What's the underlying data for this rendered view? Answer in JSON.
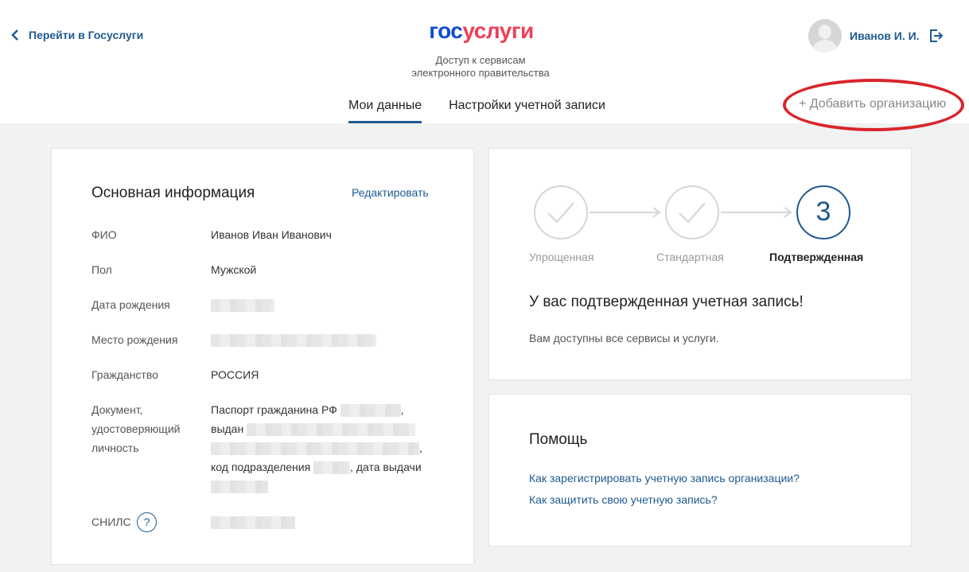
{
  "header": {
    "back_link": "Перейти в Госуслуги",
    "logo_part1": "гос",
    "logo_part2": "услуги",
    "tagline_line1": "Доступ к сервисам",
    "tagline_line2": "электронного правительства",
    "user_name": "Иванов И. И.",
    "tabs": [
      {
        "label": "Мои данные",
        "active": true
      },
      {
        "label": "Настройки учетной записи",
        "active": false
      }
    ],
    "add_org": "+ Добавить организацию"
  },
  "main_info": {
    "title": "Основная информация",
    "edit": "Редактировать",
    "rows": {
      "fio": {
        "label": "ФИО",
        "value": "Иванов Иван Иванович"
      },
      "gender": {
        "label": "Пол",
        "value": "Мужской"
      },
      "birth_date": {
        "label": "Дата рождения"
      },
      "birth_place": {
        "label": "Место рождения"
      },
      "citizenship": {
        "label": "Гражданство",
        "value": "РОССИЯ"
      },
      "document": {
        "label_line1": "Документ,",
        "label_line2": "удостоверяющий",
        "label_line3": "личность",
        "passport": "Паспорт гражданина РФ",
        "issued": "выдан",
        "dept_code": "код подразделения",
        "issue_date": ", дата выдачи",
        "comma": ","
      },
      "snils": {
        "label": "СНИЛС",
        "help": "?"
      }
    }
  },
  "status": {
    "steps": [
      {
        "label": "Упрощенная",
        "state": "done"
      },
      {
        "label": "Стандартная",
        "state": "done"
      },
      {
        "label": "Подтвержденная",
        "state": "current",
        "number": "3"
      }
    ],
    "title": "У вас подтвержденная учетная запись!",
    "description": "Вам доступны все сервисы и услуги."
  },
  "help": {
    "title": "Помощь",
    "links": [
      "Как зарегистрировать учетную запись организации?",
      "Как защитить свою учетную запись?"
    ]
  },
  "colors": {
    "accent": "#1e5a8f",
    "logo_blue": "#0d4cd3",
    "logo_red": "#ee3f58",
    "highlight": "#d8252c"
  }
}
